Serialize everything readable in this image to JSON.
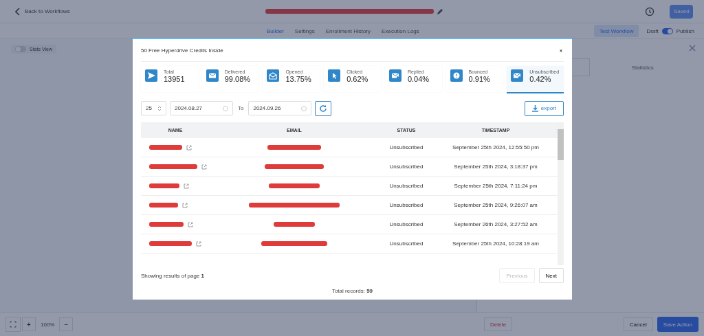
{
  "topbar": {
    "back": "Back to Workflows",
    "save": "Saved"
  },
  "tabs": [
    {
      "label": "Builder",
      "selected": true
    },
    {
      "label": "Settings",
      "selected": false
    },
    {
      "label": "Enrollment History",
      "selected": false
    },
    {
      "label": "Execution Logs",
      "selected": false
    }
  ],
  "test_button": "Test Workflow",
  "draft_label": "Draft",
  "publish_label": "Publish",
  "publish_toggle": {
    "on": true
  },
  "stats_view": {
    "label": "Stats View",
    "on": false
  },
  "side_panel": {
    "tab": "Statistics"
  },
  "zoom": {
    "level": "100%",
    "plus": "+",
    "minus": "−"
  },
  "footer_buttons": {
    "delete": "Delete",
    "cancel": "Cancel",
    "save": "Save Action"
  },
  "modal": {
    "title": "50 Free Hyperdrive Credits Inside",
    "close": "x",
    "stats": [
      {
        "kind": "total",
        "label": "Total",
        "value": "13951",
        "selected": false
      },
      {
        "kind": "delivered",
        "label": "Delivered",
        "value": "99.08%",
        "selected": false
      },
      {
        "kind": "opened",
        "label": "Opened",
        "value": "13.75%",
        "selected": false
      },
      {
        "kind": "clicked",
        "label": "Clicked",
        "value": "0.62%",
        "selected": false
      },
      {
        "kind": "replied",
        "label": "Replied",
        "value": "0.04%",
        "selected": false
      },
      {
        "kind": "bounced",
        "label": "Bounced",
        "value": "0.91%",
        "selected": false
      },
      {
        "kind": "unsubscribed",
        "label": "Unsubscribed",
        "value": "0.42%",
        "selected": true
      }
    ],
    "page_size": "25",
    "date_from": "2024.08.27",
    "to_label": "To",
    "date_to": "2024.09.26",
    "export": "export",
    "table": {
      "columns": [
        "NAME",
        "EMAIL",
        "STATUS",
        "TIMESTAMP"
      ],
      "rows": [
        {
          "status": "Unsubscribed",
          "timestamp": "September 25th 2024, 12:55:50 pm"
        },
        {
          "status": "Unsubscribed",
          "timestamp": "September 25th 2024, 3:18:37 pm"
        },
        {
          "status": "Unsubscribed",
          "timestamp": "September 25th 2024, 7:11:24 pm"
        },
        {
          "status": "Unsubscribed",
          "timestamp": "September 25th 2024, 9:26:07 am"
        },
        {
          "status": "Unsubscribed",
          "timestamp": "September 26th 2024, 3:27:52 am"
        },
        {
          "status": "Unsubscribed",
          "timestamp": "September 25th 2024, 10:28:19 am"
        }
      ]
    },
    "showing": "Showing results of page **1**",
    "previous": "Previous",
    "next": "Next",
    "total": "Total records: **59**"
  }
}
